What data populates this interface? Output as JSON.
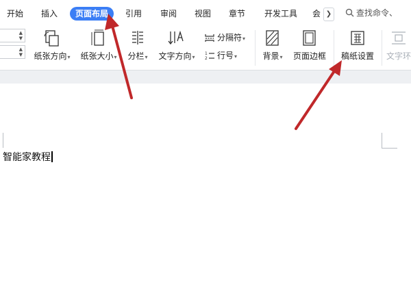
{
  "menu": {
    "tabs": [
      {
        "label": "开始"
      },
      {
        "label": "插入"
      },
      {
        "label": "页面布局"
      },
      {
        "label": "引用"
      },
      {
        "label": "审阅"
      },
      {
        "label": "视图"
      },
      {
        "label": "章节"
      },
      {
        "label": "开发工具"
      },
      {
        "label": "会"
      }
    ],
    "active_tab": "页面布局",
    "search_placeholder": "查找命令、"
  },
  "ribbon": {
    "orientation": {
      "label": "纸张方向"
    },
    "size": {
      "label": "纸张大小"
    },
    "columns": {
      "label": "分栏"
    },
    "text_direction": {
      "label": "文字方向"
    },
    "separator": {
      "label": "分隔符"
    },
    "line_number": {
      "label": "行号"
    },
    "background": {
      "label": "背景"
    },
    "page_border": {
      "label": "页面边框"
    },
    "manuscript": {
      "label": "稿纸设置"
    },
    "text_wrap": {
      "label": "文字环"
    }
  },
  "document": {
    "text": "智能家教程"
  },
  "colors": {
    "accent": "#3b7ef5",
    "annotation_arrow": "#c0282a"
  }
}
